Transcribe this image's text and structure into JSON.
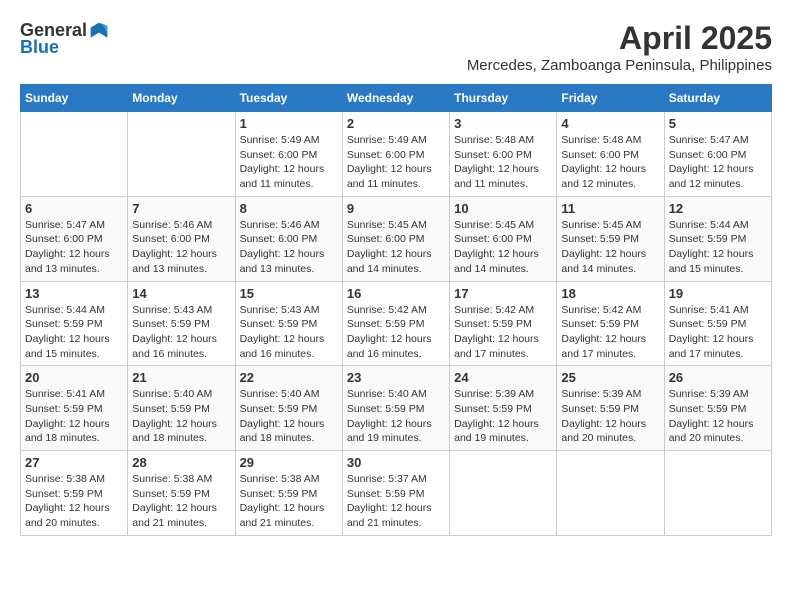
{
  "logo": {
    "general": "General",
    "blue": "Blue"
  },
  "title": "April 2025",
  "location": "Mercedes, Zamboanga Peninsula, Philippines",
  "days_of_week": [
    "Sunday",
    "Monday",
    "Tuesday",
    "Wednesday",
    "Thursday",
    "Friday",
    "Saturday"
  ],
  "weeks": [
    [
      {
        "day": "",
        "info": ""
      },
      {
        "day": "",
        "info": ""
      },
      {
        "day": "1",
        "info": "Sunrise: 5:49 AM\nSunset: 6:00 PM\nDaylight: 12 hours and 11 minutes."
      },
      {
        "day": "2",
        "info": "Sunrise: 5:49 AM\nSunset: 6:00 PM\nDaylight: 12 hours and 11 minutes."
      },
      {
        "day": "3",
        "info": "Sunrise: 5:48 AM\nSunset: 6:00 PM\nDaylight: 12 hours and 11 minutes."
      },
      {
        "day": "4",
        "info": "Sunrise: 5:48 AM\nSunset: 6:00 PM\nDaylight: 12 hours and 12 minutes."
      },
      {
        "day": "5",
        "info": "Sunrise: 5:47 AM\nSunset: 6:00 PM\nDaylight: 12 hours and 12 minutes."
      }
    ],
    [
      {
        "day": "6",
        "info": "Sunrise: 5:47 AM\nSunset: 6:00 PM\nDaylight: 12 hours and 13 minutes."
      },
      {
        "day": "7",
        "info": "Sunrise: 5:46 AM\nSunset: 6:00 PM\nDaylight: 12 hours and 13 minutes."
      },
      {
        "day": "8",
        "info": "Sunrise: 5:46 AM\nSunset: 6:00 PM\nDaylight: 12 hours and 13 minutes."
      },
      {
        "day": "9",
        "info": "Sunrise: 5:45 AM\nSunset: 6:00 PM\nDaylight: 12 hours and 14 minutes."
      },
      {
        "day": "10",
        "info": "Sunrise: 5:45 AM\nSunset: 6:00 PM\nDaylight: 12 hours and 14 minutes."
      },
      {
        "day": "11",
        "info": "Sunrise: 5:45 AM\nSunset: 5:59 PM\nDaylight: 12 hours and 14 minutes."
      },
      {
        "day": "12",
        "info": "Sunrise: 5:44 AM\nSunset: 5:59 PM\nDaylight: 12 hours and 15 minutes."
      }
    ],
    [
      {
        "day": "13",
        "info": "Sunrise: 5:44 AM\nSunset: 5:59 PM\nDaylight: 12 hours and 15 minutes."
      },
      {
        "day": "14",
        "info": "Sunrise: 5:43 AM\nSunset: 5:59 PM\nDaylight: 12 hours and 16 minutes."
      },
      {
        "day": "15",
        "info": "Sunrise: 5:43 AM\nSunset: 5:59 PM\nDaylight: 12 hours and 16 minutes."
      },
      {
        "day": "16",
        "info": "Sunrise: 5:42 AM\nSunset: 5:59 PM\nDaylight: 12 hours and 16 minutes."
      },
      {
        "day": "17",
        "info": "Sunrise: 5:42 AM\nSunset: 5:59 PM\nDaylight: 12 hours and 17 minutes."
      },
      {
        "day": "18",
        "info": "Sunrise: 5:42 AM\nSunset: 5:59 PM\nDaylight: 12 hours and 17 minutes."
      },
      {
        "day": "19",
        "info": "Sunrise: 5:41 AM\nSunset: 5:59 PM\nDaylight: 12 hours and 17 minutes."
      }
    ],
    [
      {
        "day": "20",
        "info": "Sunrise: 5:41 AM\nSunset: 5:59 PM\nDaylight: 12 hours and 18 minutes."
      },
      {
        "day": "21",
        "info": "Sunrise: 5:40 AM\nSunset: 5:59 PM\nDaylight: 12 hours and 18 minutes."
      },
      {
        "day": "22",
        "info": "Sunrise: 5:40 AM\nSunset: 5:59 PM\nDaylight: 12 hours and 18 minutes."
      },
      {
        "day": "23",
        "info": "Sunrise: 5:40 AM\nSunset: 5:59 PM\nDaylight: 12 hours and 19 minutes."
      },
      {
        "day": "24",
        "info": "Sunrise: 5:39 AM\nSunset: 5:59 PM\nDaylight: 12 hours and 19 minutes."
      },
      {
        "day": "25",
        "info": "Sunrise: 5:39 AM\nSunset: 5:59 PM\nDaylight: 12 hours and 20 minutes."
      },
      {
        "day": "26",
        "info": "Sunrise: 5:39 AM\nSunset: 5:59 PM\nDaylight: 12 hours and 20 minutes."
      }
    ],
    [
      {
        "day": "27",
        "info": "Sunrise: 5:38 AM\nSunset: 5:59 PM\nDaylight: 12 hours and 20 minutes."
      },
      {
        "day": "28",
        "info": "Sunrise: 5:38 AM\nSunset: 5:59 PM\nDaylight: 12 hours and 21 minutes."
      },
      {
        "day": "29",
        "info": "Sunrise: 5:38 AM\nSunset: 5:59 PM\nDaylight: 12 hours and 21 minutes."
      },
      {
        "day": "30",
        "info": "Sunrise: 5:37 AM\nSunset: 5:59 PM\nDaylight: 12 hours and 21 minutes."
      },
      {
        "day": "",
        "info": ""
      },
      {
        "day": "",
        "info": ""
      },
      {
        "day": "",
        "info": ""
      }
    ]
  ]
}
